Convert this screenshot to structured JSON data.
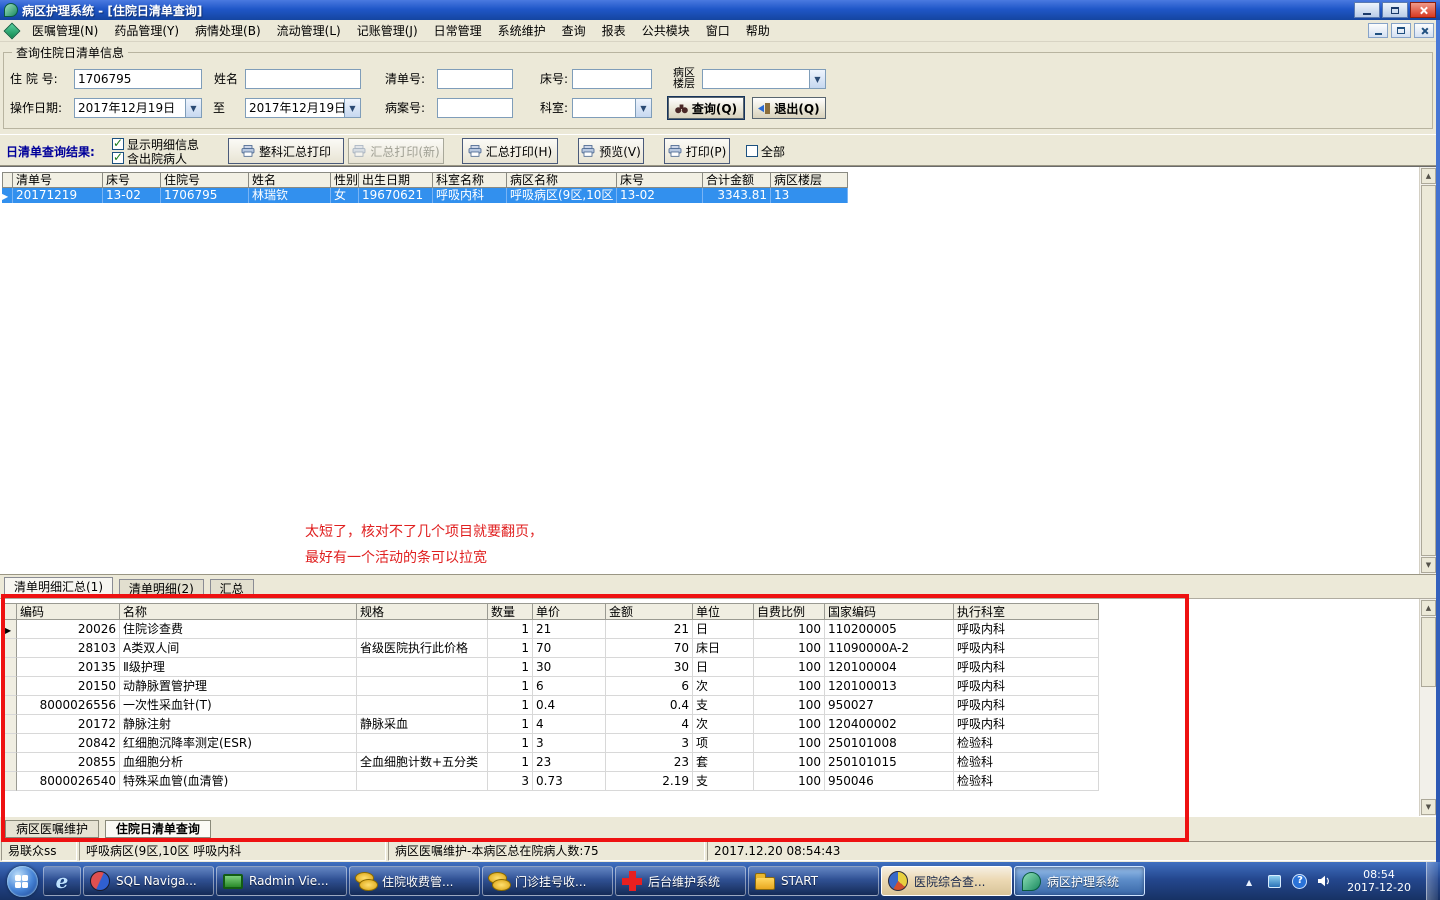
{
  "titlebar": {
    "title": "病区护理系统 - [住院日清单查询]"
  },
  "menu": {
    "items": [
      "医嘱管理(N)",
      "药品管理(Y)",
      "病情处理(B)",
      "流动管理(L)",
      "记账管理(J)",
      "日常管理",
      "系统维护",
      "查询",
      "报表",
      "公共模块",
      "窗口",
      "帮助"
    ]
  },
  "query": {
    "group_title": "查询住院日清单信息",
    "admission_label": "住 院 号:",
    "admission_value": "1706795",
    "name_label": "姓名",
    "list_no_label": "清单号:",
    "bed_label": "床号:",
    "ward_floor_line1": "病区",
    "ward_floor_line2": "楼层",
    "date_label": "操作日期:",
    "date_from": "2017年12月19日",
    "to_label": "至",
    "date_to": "2017年12月19日",
    "case_label": "病案号:",
    "dept_label": "科室:",
    "query_btn": "查询(Q)",
    "exit_btn": "退出(Q)"
  },
  "result_bar": {
    "label": "日清单查询结果:",
    "chk_detail": "显示明细信息",
    "chk_discharged": "含出院病人",
    "btn_dept_print": "整科汇总打印",
    "btn_sum_print_new": "汇总打印(新)",
    "btn_sum_print": "汇总打印(H)",
    "btn_preview": "预览(V)",
    "btn_print": "打印(P)",
    "chk_all": "全部"
  },
  "results": {
    "headers": [
      "清单号",
      "床号",
      "住院号",
      "姓名",
      "性别",
      "出生日期",
      "科室名称",
      "病区名称",
      "床号",
      "合计金额",
      "病区楼层"
    ],
    "row": [
      "20171219",
      "13-02",
      "1706795",
      "林瑞钦",
      "女",
      "19670621",
      "呼吸内科",
      "呼吸病区(9区,10区",
      "13-02",
      "3343.81",
      "13"
    ]
  },
  "annotation": {
    "line1": "太短了，核对不了几个项目就要翻页，",
    "line2": "最好有一个活动的条可以拉宽"
  },
  "detail": {
    "tabs": [
      "清单明细汇总(1)",
      "清单明细(2)",
      "汇总"
    ],
    "headers": [
      "编码",
      "名称",
      "规格",
      "数量",
      "单价",
      "金额",
      "单位",
      "自费比例",
      "国家编码",
      "执行科室"
    ],
    "rows": [
      [
        "20026",
        "住院诊查费",
        "",
        "1",
        "21",
        "21",
        "日",
        "100",
        "110200005",
        "呼吸内科"
      ],
      [
        "28103",
        "A类双人间",
        "省级医院执行此价格",
        "1",
        "70",
        "70",
        "床日",
        "100",
        "11090000A-2",
        "呼吸内科"
      ],
      [
        "20135",
        "Ⅱ级护理",
        "",
        "1",
        "30",
        "30",
        "日",
        "100",
        "120100004",
        "呼吸内科"
      ],
      [
        "20150",
        "动静脉置管护理",
        "",
        "1",
        "6",
        "6",
        "次",
        "100",
        "120100013",
        "呼吸内科"
      ],
      [
        "8000026556",
        "一次性采血针(T)",
        "",
        "1",
        "0.4",
        "0.4",
        "支",
        "100",
        "950027",
        "呼吸内科"
      ],
      [
        "20172",
        "静脉注射",
        "静脉采血",
        "1",
        "4",
        "4",
        "次",
        "100",
        "120400002",
        "呼吸内科"
      ],
      [
        "20842",
        "红细胞沉降率测定(ESR)",
        "",
        "1",
        "3",
        "3",
        "项",
        "100",
        "250101008",
        "检验科"
      ],
      [
        "20855",
        "血细胞分析",
        "全血细胞计数+五分类",
        "1",
        "23",
        "23",
        "套",
        "100",
        "250101015",
        "检验科"
      ],
      [
        "8000026540",
        "特殊采血管(血清管)",
        "",
        "3",
        "0.73",
        "2.19",
        "支",
        "100",
        "950046",
        "检验科"
      ]
    ]
  },
  "doc_tabs": [
    "病区医嘱维护",
    "住院日清单查询"
  ],
  "statusbar": {
    "user": "易联众ss",
    "ward": "呼吸病区(9区,10区 呼吸内科",
    "info": "病区医嘱维护-本病区总在院病人数:75",
    "datetime": "2017.12.20 08:54:43"
  },
  "taskbar": {
    "buttons": [
      {
        "label": "SQL Naviga...",
        "icon": "sql-navigator-icon"
      },
      {
        "label": "Radmin Vie...",
        "icon": "radmin-viewer-icon"
      },
      {
        "label": "住院收费管...",
        "icon": "coins-icon"
      },
      {
        "label": "门诊挂号收...",
        "icon": "coins-icon"
      },
      {
        "label": "后台维护系统",
        "icon": "red-cross-icon"
      },
      {
        "label": "START",
        "icon": "folder-icon"
      },
      {
        "label": "医院综合查...",
        "icon": "pie-chart-icon"
      },
      {
        "label": "病区护理系统",
        "icon": "ward-system-icon"
      }
    ],
    "clock_time": "08:54",
    "clock_date": "2017-12-20"
  },
  "icons": {
    "dropdown-arrow": "▼",
    "scroll-up-arrow": "▲",
    "scroll-down-arrow": "▼",
    "current-row-marker": "▶",
    "checkbox-check": "✓",
    "printer": "printer-glyph",
    "binoculars": "binoculars-glyph",
    "exit-door": "exit-glyph"
  },
  "colors": {
    "titlebar_blue": "#2057c8",
    "selection_blue": "#3290ee",
    "annotation_red": "#e02020",
    "highlight_box_red": "#ee1111",
    "taskbar_blue": "#24478e",
    "panel_gray": "#ece9d8"
  }
}
